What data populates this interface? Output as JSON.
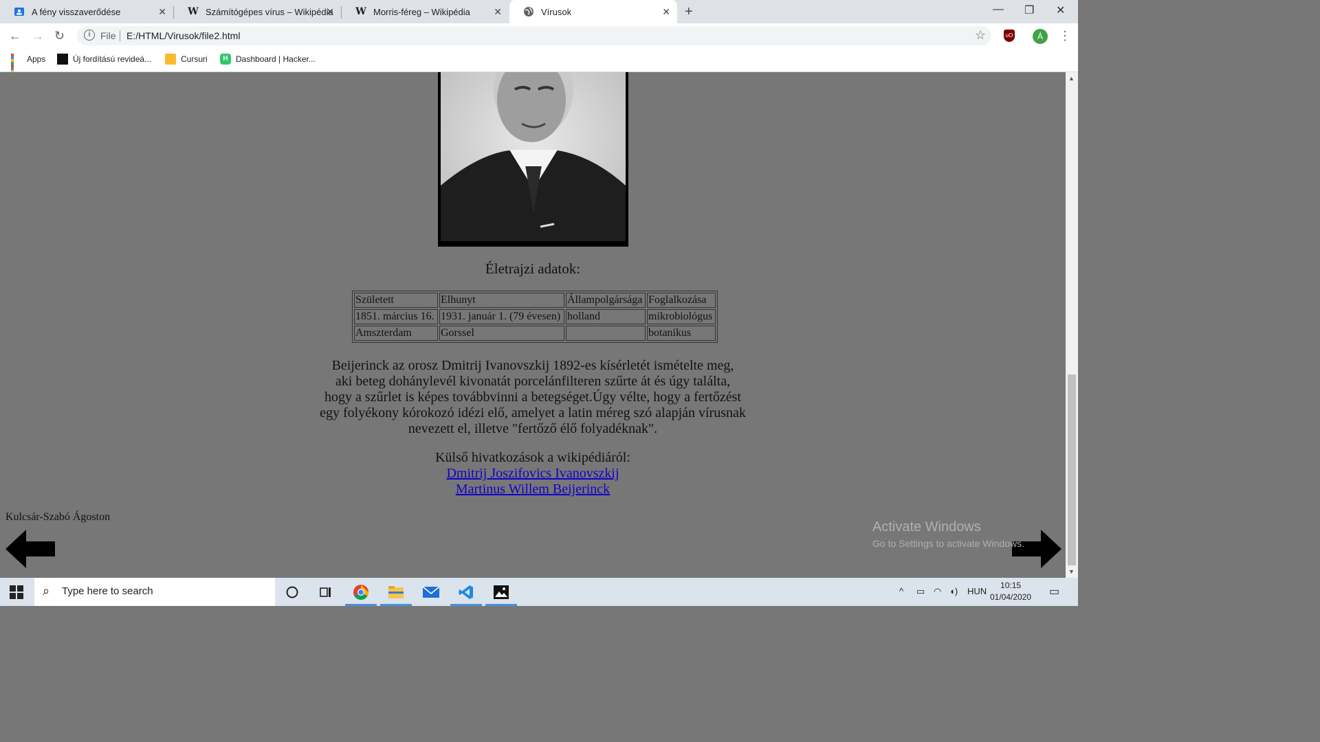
{
  "tabs": [
    {
      "title": "A fény visszaverődése",
      "favicon": "classroom-icon"
    },
    {
      "title": "Számítógépes vírus – Wikipédia",
      "favicon": "wikipedia-icon"
    },
    {
      "title": "Morris-féreg – Wikipédia",
      "favicon": "wikipedia-icon"
    },
    {
      "title": "Vírusok",
      "favicon": "globe-icon",
      "active": true
    }
  ],
  "toolbar": {
    "scheme": "File",
    "url": "E:/HTML/Virusok/file2.html",
    "profile_initial": "Á"
  },
  "bookmarks": [
    {
      "label": "Apps"
    },
    {
      "label": "Új fordítású revideá..."
    },
    {
      "label": "Cursuri"
    },
    {
      "label": "Dashboard | Hacker..."
    }
  ],
  "page": {
    "heading": "Életrajzi adatok:",
    "table": [
      [
        "Született",
        "Elhunyt",
        "Állampolgársága",
        "Foglalkozása"
      ],
      [
        "1851. március 16.",
        "1931. január 1. (79 évesen)",
        "holland",
        "mikrobiológus"
      ],
      [
        "Amszterdam",
        "Gorssel",
        "",
        "botanikus"
      ]
    ],
    "paragraph_lines": [
      "Beijerinck az orosz Dmitrij Ivanovszkij 1892-es kísérletét ismételte meg,",
      "aki beteg dohánylevél kivonatát porcelánfilteren szűrte át és úgy találta,",
      "hogy a szűrlet is képes továbbvinni a betegséget.Úgy vélte, hogy a fertőzést",
      "egy folyékony kórokozó idézi elő, amelyet a latin méreg szó alapján vírusnak",
      "nevezett el, illetve \"fertőző élő folyadéknak\"."
    ],
    "links_title": "Külső hivatkozások a wikipédiáról:",
    "links": [
      "Dmitrij Joszifovics Ivanovszkij",
      "Martinus Willem Beijerinck"
    ],
    "author": "Kulcsár-Szabó Ágoston"
  },
  "watermark": {
    "line1": "Activate Windows",
    "line2": "Go to Settings to activate Windows."
  },
  "taskbar": {
    "search_placeholder": "Type here to search",
    "language": "HUN",
    "time": "10:15",
    "date": "01/04/2020"
  }
}
